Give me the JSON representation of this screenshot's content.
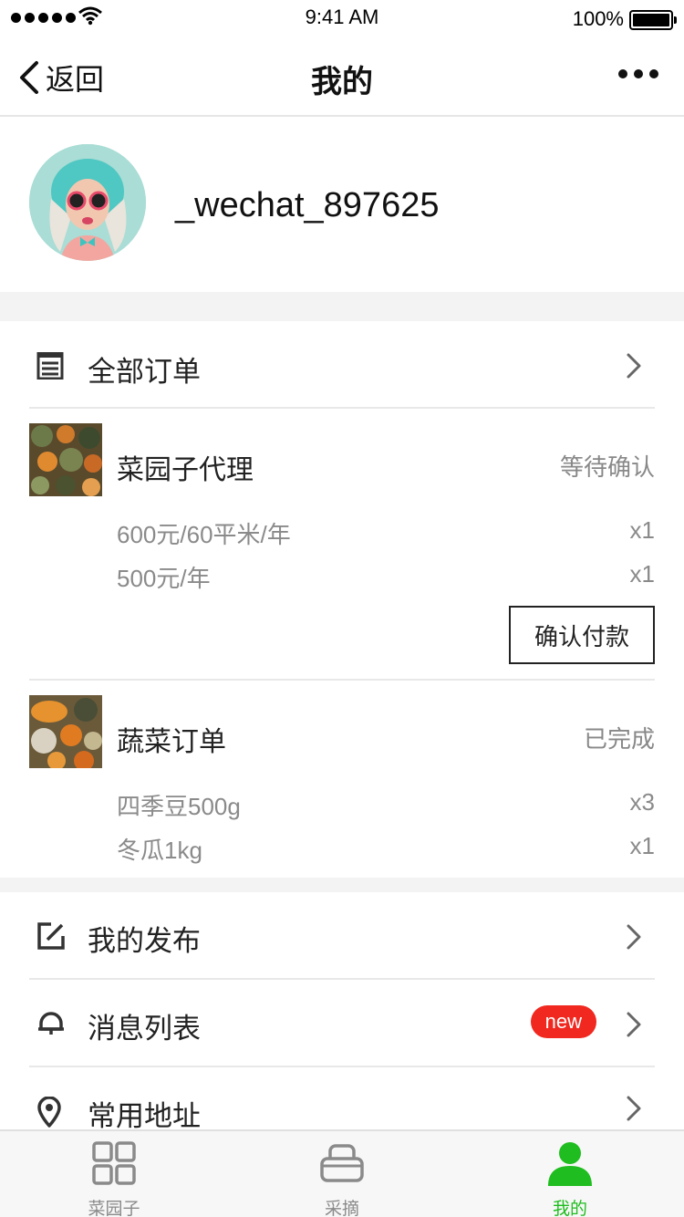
{
  "status_bar": {
    "time": "9:41 AM",
    "battery": "100%"
  },
  "nav": {
    "back_label": "返回",
    "title": "我的"
  },
  "profile": {
    "username": "_wechat_897625"
  },
  "orders": {
    "header_label": "全部订单",
    "list": [
      {
        "title": "菜园子代理",
        "status": "等待确认",
        "items": [
          {
            "name": "600元/60平米/年",
            "qty": "x1"
          },
          {
            "name": "500元/年",
            "qty": "x1"
          }
        ],
        "action_label": "确认付款"
      },
      {
        "title": "蔬菜订单",
        "status": "已完成",
        "items": [
          {
            "name": "四季豆500g",
            "qty": "x3"
          },
          {
            "name": "冬瓜1kg",
            "qty": "x1"
          }
        ]
      }
    ]
  },
  "menu": {
    "items": [
      {
        "label": "我的发布",
        "icon": "edit-icon"
      },
      {
        "label": "消息列表",
        "icon": "bell-icon",
        "badge": "new"
      },
      {
        "label": "常用地址",
        "icon": "location-pin-icon"
      }
    ]
  },
  "tabbar": {
    "tabs": [
      {
        "label": "菜园子",
        "icon": "grid-icon",
        "active": false
      },
      {
        "label": "采摘",
        "icon": "basket-icon",
        "active": false
      },
      {
        "label": "我的",
        "icon": "user-icon",
        "active": true
      }
    ],
    "active_color": "#1fbd1f",
    "inactive_color": "#8a8a8a"
  },
  "colors": {
    "badge": "#f0281f",
    "background": "#f3f3f3"
  }
}
